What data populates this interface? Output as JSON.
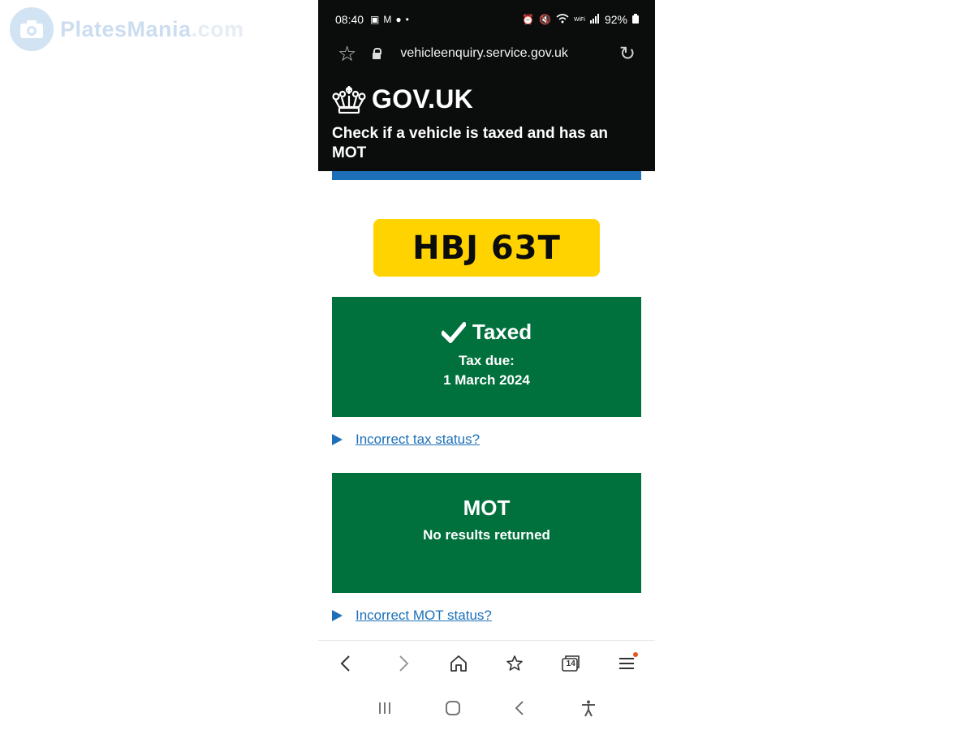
{
  "watermark": {
    "brand_main": "PlatesMania",
    "brand_suffix": ".com"
  },
  "status_bar": {
    "time": "08:40",
    "battery": "92%",
    "wifi_label": "WiFi"
  },
  "browser": {
    "url": "vehicleenquiry.service.gov.uk"
  },
  "header": {
    "logo_text": "GOV.UK",
    "service_name": "Check if a vehicle is taxed and has an MOT"
  },
  "vehicle": {
    "registration": "HBJ 63T"
  },
  "tax": {
    "status": "Taxed",
    "due_label": "Tax due:",
    "due_date": "1 March 2024",
    "incorrect_link": "Incorrect tax status?"
  },
  "mot": {
    "status": "MOT",
    "detail": "No results returned",
    "incorrect_link": "Incorrect MOT status?"
  },
  "bottom_nav": {
    "tab_count": "14"
  },
  "colors": {
    "govuk_black": "#0b0c0c",
    "govuk_blue": "#1d70b8",
    "govuk_green": "#00703c",
    "plate_yellow": "#ffd300"
  }
}
